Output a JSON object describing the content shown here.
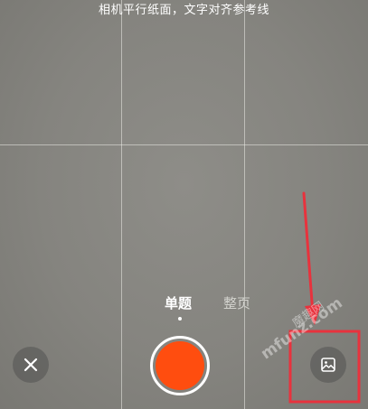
{
  "camera": {
    "hint": "相机平行纸面，文字对齐参考线",
    "grid": {
      "columns": 3,
      "rows": 2
    }
  },
  "modes": {
    "items": [
      "单题",
      "整页"
    ],
    "selected": "单题"
  },
  "controls": {
    "close_icon": "close-icon",
    "shutter_color": "#ff4d0f",
    "gallery_icon": "image-icon"
  },
  "annotation": {
    "color": "#e8323d"
  },
  "watermark": {
    "brand": "魔趣网",
    "domain": "mfunz.com"
  }
}
